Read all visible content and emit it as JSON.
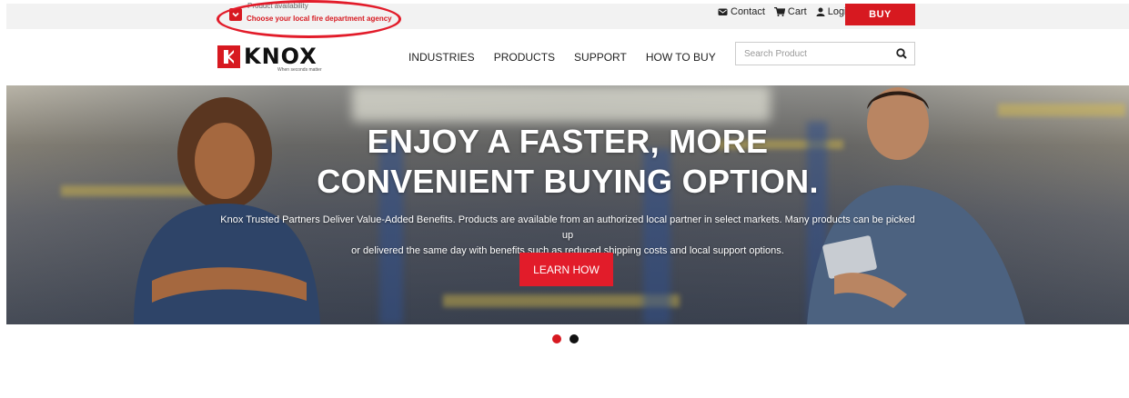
{
  "topbar": {
    "availability_small": "Product availability",
    "availability_main": "Choose your local fire department agency",
    "contact_label": "Contact",
    "cart_label": "Cart",
    "login_label": "Login",
    "buy_label": "BUY"
  },
  "brand": {
    "name": "KNOX",
    "tagline": "When seconds matter",
    "color": "#d71920"
  },
  "nav": {
    "items": [
      "INDUSTRIES",
      "PRODUCTS",
      "SUPPORT",
      "HOW TO BUY"
    ]
  },
  "search": {
    "placeholder": "Search Product",
    "icon": "search-icon"
  },
  "hero": {
    "title_line1": "ENJOY A FASTER, MORE",
    "title_line2": "CONVENIENT BUYING OPTION.",
    "body_line1": "Knox Trusted Partners Deliver Value-Added Benefits. Products are available from an authorized local partner in select markets. Many products can be picked up",
    "body_line2": "or delivered the same day with benefits such as reduced shipping costs and local support options.",
    "cta_label": "LEARN HOW",
    "cta_color": "#e21c2a"
  },
  "carousel": {
    "total_slides": 2,
    "active_index": 0
  }
}
